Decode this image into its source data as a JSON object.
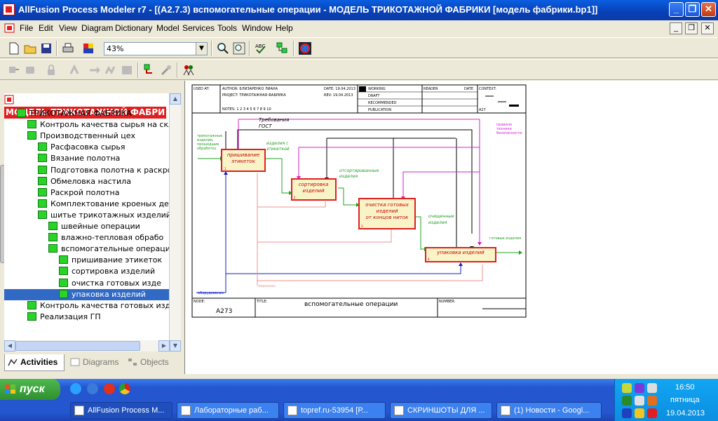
{
  "window": {
    "title": "AllFusion Process Modeler r7 - [(A2.7.3) вспомогательные   операции - МОДЕЛЬ ТРИКОТАЖНОЙ ФАБРИКИ  [модель фабрики.bp1]]"
  },
  "menu": [
    "File",
    "Edit",
    "View",
    "Diagram",
    "Dictionary",
    "Model",
    "Services",
    "Tools",
    "Window",
    "Help"
  ],
  "toolbar": {
    "zoom": "43%"
  },
  "tree": {
    "root": "МОДЕЛЬ ТРИКОТАЖНОЙ ФАБРИ",
    "items": [
      {
        "label": "ТРИКОТАЖНАЯ ФАБРИКА"
      },
      {
        "label": "Контроль качества  сырья на скла"
      },
      {
        "label": "Производственный цех"
      },
      {
        "label": "Расфасовка  сырья"
      },
      {
        "label": "Вязание  полотна"
      },
      {
        "label": "Подготовка  полотна к раскрою"
      },
      {
        "label": "Обмеловка  настила"
      },
      {
        "label": "Раскрой полотна"
      },
      {
        "label": "Комплектование  кроеных   де"
      },
      {
        "label": "шитье  трикотажных  изделий"
      },
      {
        "label": "швейные операции"
      },
      {
        "label": "влажно-тепловая     обрабо"
      },
      {
        "label": "вспомогательные   операци"
      },
      {
        "label": "пришивание этикеток"
      },
      {
        "label": "сортировка  изделий"
      },
      {
        "label": "очистка готовых     изде"
      },
      {
        "label": "упаковка изделий"
      },
      {
        "label": "Контроль качества  готовых изде"
      },
      {
        "label": "Реализация ГП"
      }
    ]
  },
  "tabs": [
    "Activities",
    "Diagrams",
    "Objects"
  ],
  "diagram": {
    "header": {
      "used_at": "USED AT:",
      "author": "AUTHOR:  БЛИЗАРЕНКО ЛИАНА",
      "date": "DATE: 19.04.2013",
      "project": "PROJECT:  ТРИКОТАЖНАЯ ФАБРИКА",
      "rev": "REV:   19.04.2013",
      "notes": "NOTES:  1  2  3  4  5  6  7  8  9  10",
      "working": "WORKING",
      "draft": "DRAFT",
      "recommended": "RECOMMENDED",
      "publication": "PUBLICATION",
      "reader": "READER",
      "date2": "DATE",
      "context": "CONTEXT:",
      "context_node": "A27"
    },
    "footer": {
      "node_label": "NODE:",
      "node": "A273",
      "title_label": "TITLE:",
      "title": "вспомогательные   операции",
      "number_label": "NUMBER:"
    },
    "boxes": [
      {
        "label1": "пришивание",
        "label2": "этикеток",
        "num": "1"
      },
      {
        "label1": "сортировка",
        "label2": "изделий",
        "num": "2"
      },
      {
        "label1": "очистка готовых",
        "label2": "изделий",
        "label3": "от концов ниток",
        "num": "3"
      },
      {
        "label1": "упаковка изделий",
        "num": "4"
      }
    ],
    "arrows": {
      "requirements1": "Требования",
      "requirements2": "ГОСТ",
      "input1": "трикотажные",
      "input2": "изделия,",
      "input3": "прошедшие",
      "input4": "обработку",
      "out1a": "изделия с",
      "out1b": "этикеткой",
      "out2a": "отсортированные",
      "out2b": "изделия",
      "out3a": "очищенные",
      "out3b": "изделия",
      "out4": "готовые изделия",
      "safety1": "правила",
      "safety2": "техники",
      "safety3": "безопасности",
      "equipment": "оборудование",
      "personnel": "персонал"
    }
  },
  "taskbar": {
    "start": "пуск",
    "tasks": [
      "AllFusion Process M...",
      "Лабораторные раб...",
      "topref.ru-53954 [Р...",
      "СКРИНШОТЫ ДЛЯ ...",
      "(1) Новости - Googl..."
    ],
    "time": "16:50",
    "day": "пятница",
    "date": "19.04.2013"
  }
}
